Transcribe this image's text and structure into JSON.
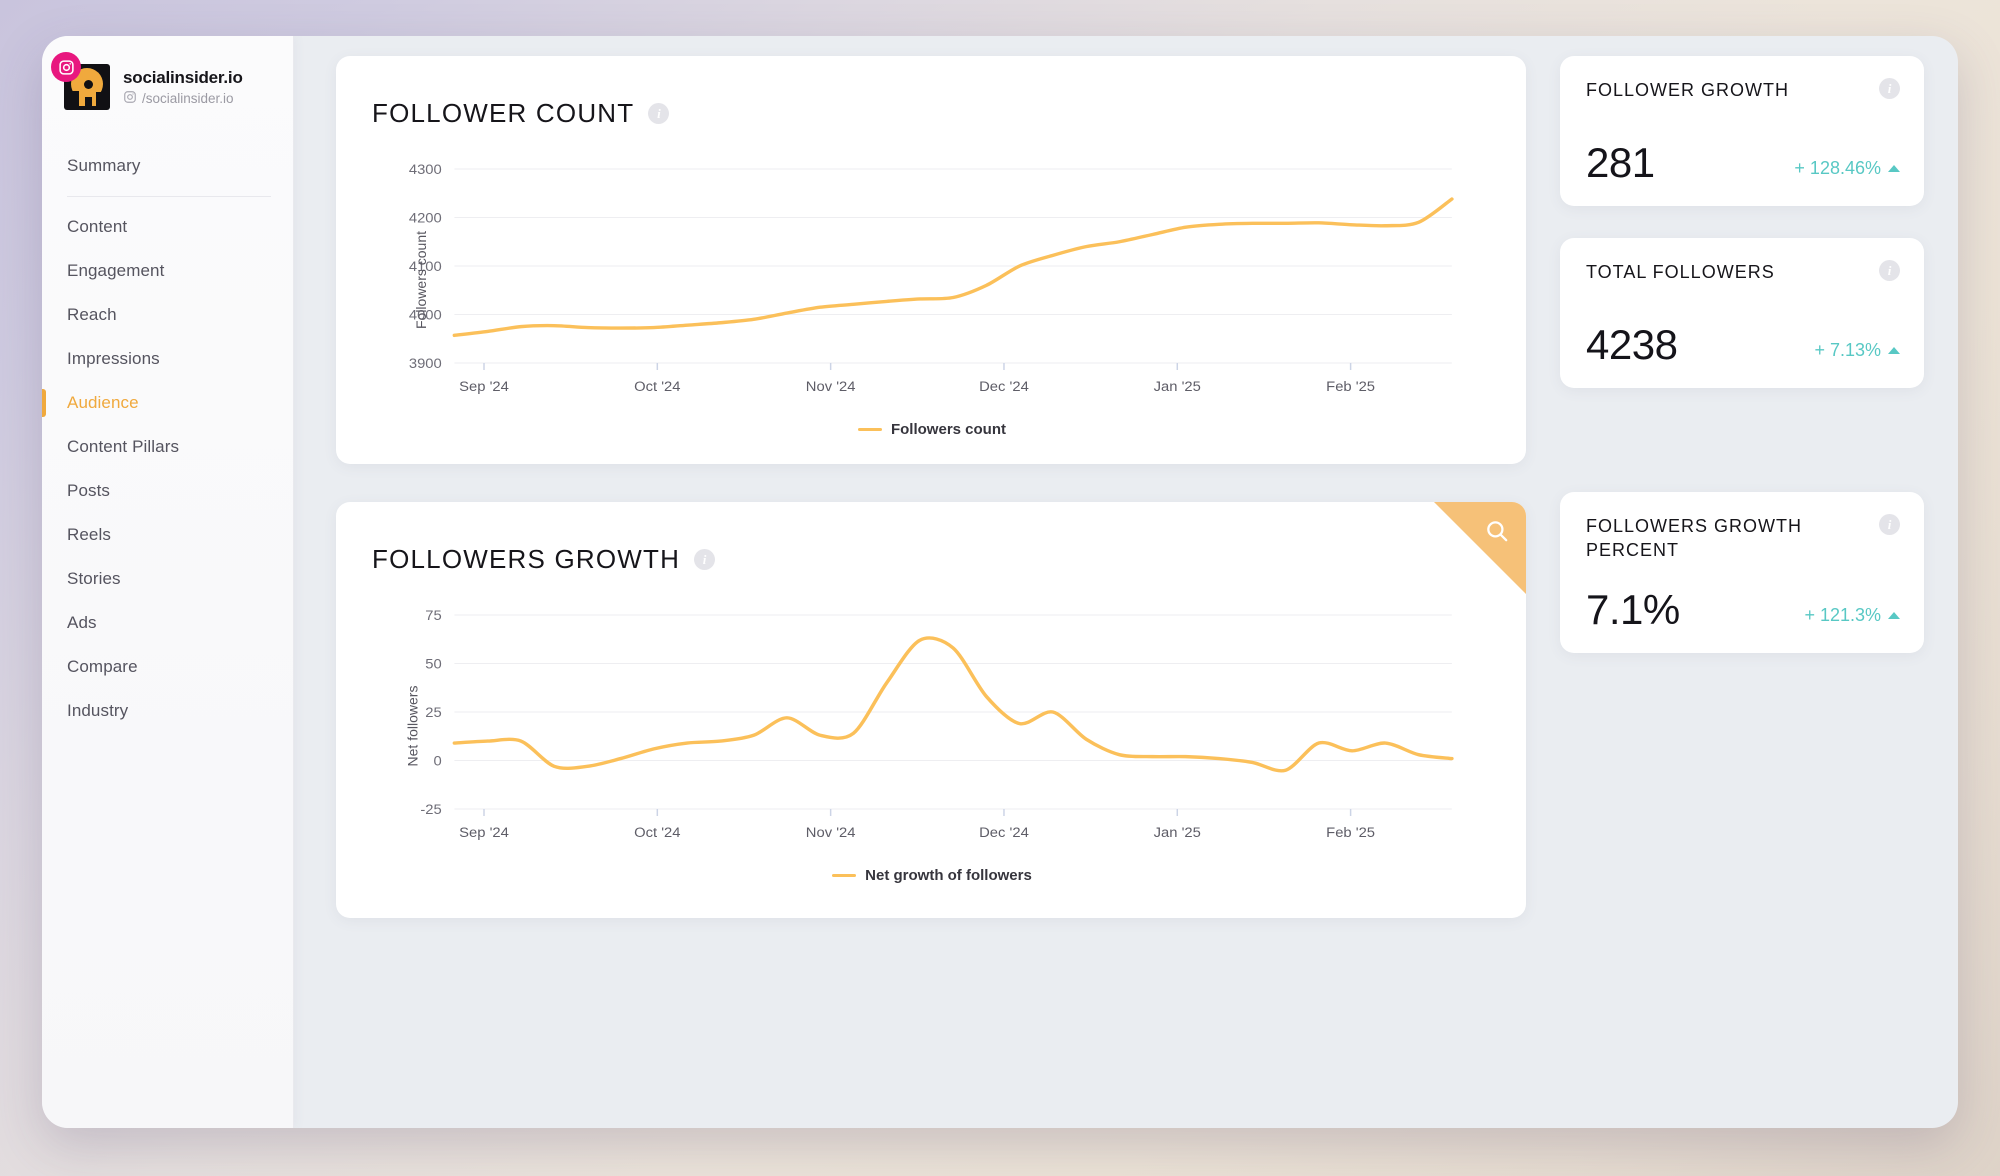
{
  "sidebar": {
    "profile": {
      "name": "socialinsider.io",
      "handle": "/socialinsider.io",
      "network_icon": "instagram-icon",
      "avatar_icon": "profile-avatar"
    },
    "items": [
      {
        "label": "Summary",
        "active": false
      },
      {
        "label": "Content",
        "active": false
      },
      {
        "label": "Engagement",
        "active": false
      },
      {
        "label": "Reach",
        "active": false
      },
      {
        "label": "Impressions",
        "active": false
      },
      {
        "label": "Audience",
        "active": true
      },
      {
        "label": "Content Pillars",
        "active": false
      },
      {
        "label": "Posts",
        "active": false
      },
      {
        "label": "Reels",
        "active": false
      },
      {
        "label": "Stories",
        "active": false
      },
      {
        "label": "Ads",
        "active": false
      },
      {
        "label": "Compare",
        "active": false
      },
      {
        "label": "Industry",
        "active": false
      }
    ]
  },
  "charts": [
    {
      "title": "FOLLOWER COUNT",
      "info_icon": "info-icon",
      "legend": "Followers count",
      "has_corner_badge": false
    },
    {
      "title": "FOLLOWERS GROWTH",
      "info_icon": "info-icon",
      "legend": "Net growth of followers",
      "has_corner_badge": true,
      "corner_badge_icon": "magnifier-icon"
    }
  ],
  "stat_cards": [
    {
      "label": "FOLLOWER GROWTH",
      "value": "281",
      "delta": "+ 128.46%",
      "direction": "up",
      "info_icon": "info-icon"
    },
    {
      "label": "TOTAL FOLLOWERS",
      "value": "4238",
      "delta": "+ 7.13%",
      "direction": "up",
      "info_icon": "info-icon"
    },
    {
      "label": "FOLLOWERS GROWTH PERCENT",
      "value": "7.1%",
      "delta": "+ 121.3%",
      "direction": "up",
      "info_icon": "info-icon"
    }
  ],
  "colors": {
    "accent_orange": "#f0a93d",
    "line_orange": "#fbc05a",
    "delta_teal": "#58c8c4",
    "instagram_pink": "#e8177f",
    "badge_orange": "#f6c178"
  },
  "chart_data": [
    {
      "type": "line",
      "title": "FOLLOWER COUNT",
      "xlabel": "",
      "ylabel": "Followers count",
      "ylim": [
        3900,
        4300
      ],
      "yticks": [
        3900,
        4000,
        4100,
        4200,
        4300
      ],
      "xticks": [
        "Sep '24",
        "Oct '24",
        "Nov '24",
        "Dec '24",
        "Jan '25",
        "Feb '25"
      ],
      "grid": true,
      "legend": "Followers count",
      "legend_position": "bottom-center",
      "series": [
        {
          "name": "Followers count",
          "color": "#fbc05a",
          "x": [
            0,
            2,
            4,
            6,
            8,
            10,
            12,
            14,
            16,
            18,
            20,
            22,
            24,
            26,
            28,
            30,
            32,
            34,
            36,
            38,
            40,
            42,
            44,
            46,
            48,
            50,
            52,
            54,
            56,
            58,
            60
          ],
          "values": [
            3957,
            3965,
            3975,
            3977,
            3973,
            3972,
            3973,
            3978,
            3983,
            3990,
            4003,
            4015,
            4021,
            4027,
            4032,
            4035,
            4060,
            4100,
            4122,
            4140,
            4150,
            4165,
            4180,
            4186,
            4188,
            4188,
            4189,
            4185,
            4183,
            4190,
            4238
          ]
        }
      ]
    },
    {
      "type": "line",
      "title": "FOLLOWERS GROWTH",
      "xlabel": "",
      "ylabel": "Net followers",
      "ylim": [
        -25,
        75
      ],
      "yticks": [
        -25,
        0,
        25,
        50,
        75
      ],
      "xticks": [
        "Sep '24",
        "Oct '24",
        "Nov '24",
        "Dec '24",
        "Jan '25",
        "Feb '25"
      ],
      "grid": true,
      "legend": "Net growth of followers",
      "legend_position": "bottom-center",
      "series": [
        {
          "name": "Net growth of followers",
          "color": "#fbc05a",
          "x": [
            0,
            2,
            4,
            6,
            8,
            10,
            12,
            14,
            16,
            18,
            20,
            22,
            24,
            26,
            28,
            30,
            32,
            34,
            36,
            38,
            40,
            42,
            44,
            46,
            48,
            50,
            52,
            54,
            56,
            58,
            60
          ],
          "values": [
            9,
            10,
            10,
            -3,
            -3,
            1,
            6,
            9,
            10,
            13,
            22,
            13,
            14,
            40,
            62,
            58,
            33,
            19,
            25,
            11,
            3,
            2,
            2,
            1,
            -1,
            -5,
            9,
            5,
            9,
            3,
            1
          ]
        }
      ]
    }
  ]
}
